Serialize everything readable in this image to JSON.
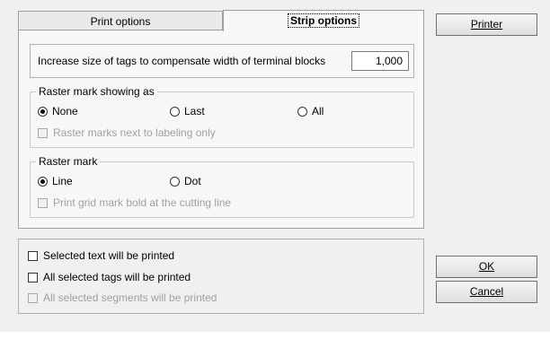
{
  "tabs": {
    "print_options": "Print options",
    "strip_options": "Strip options"
  },
  "tag_size": {
    "label": "Increase size of tags to compensate width of terminal blocks",
    "value": "1,000"
  },
  "raster_showing": {
    "title": "Raster mark showing as",
    "options": [
      "None",
      "Last",
      "All"
    ],
    "selected": "None",
    "checkbox_label": "Raster marks next to labeling only"
  },
  "raster_mark": {
    "title": "Raster mark",
    "options": [
      "Line",
      "Dot"
    ],
    "selected": "Line",
    "checkbox_label": "Print grid mark bold at the cutting line"
  },
  "print_selection": {
    "selected_text": "Selected text will be printed",
    "selected_tags": "All selected tags will be printed",
    "selected_segments": "All selected segments will be printed"
  },
  "buttons": {
    "printer": "Printer",
    "ok": "OK",
    "cancel": "Cancel"
  }
}
